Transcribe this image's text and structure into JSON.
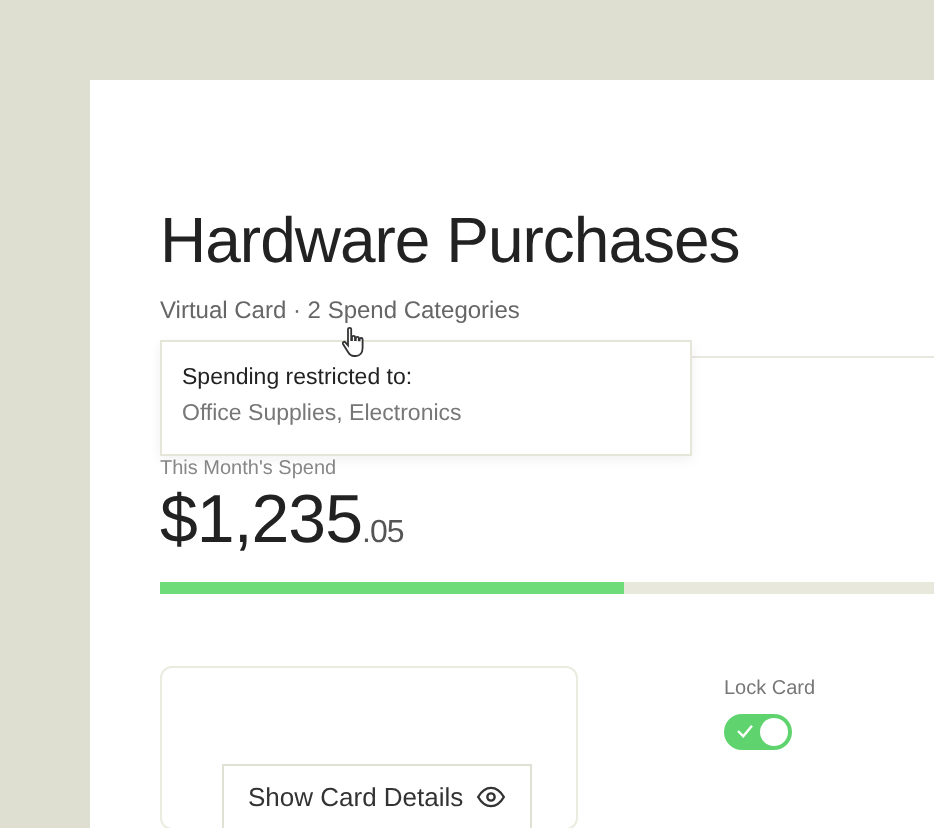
{
  "title": "Hardware Purchases",
  "subtitle": "Virtual Card · 2 Spend Categories",
  "tooltip": {
    "heading": "Spending restricted to:",
    "body": "Office Supplies, Electronics"
  },
  "spend": {
    "label": "This Month's Spend",
    "whole": "$1,235",
    "cents": ".05",
    "level": 0.6
  },
  "card": {
    "button": "Show Card Details"
  },
  "lock": {
    "label": "Lock Card",
    "on": true
  }
}
